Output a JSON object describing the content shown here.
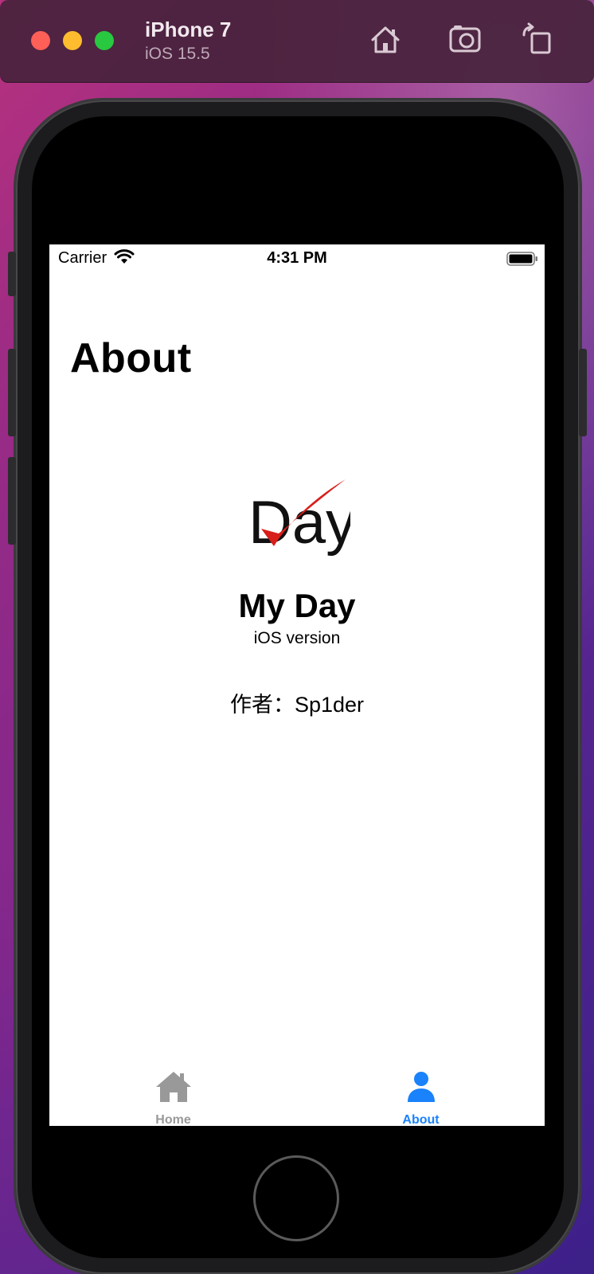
{
  "simulator": {
    "device_name": "iPhone 7",
    "os_version": "iOS 15.5",
    "icons": [
      "home-icon",
      "screenshot-camera-icon",
      "rotate-icon"
    ]
  },
  "status_bar": {
    "carrier": "Carrier",
    "time": "4:31 PM"
  },
  "page": {
    "title": "About",
    "logo_text": "Day",
    "app_name": "My Day",
    "app_subtitle": "iOS version",
    "author": "作者：Sp1der"
  },
  "tab_bar": {
    "items": [
      {
        "label": "Home",
        "icon": "house-icon",
        "selected": false
      },
      {
        "label": "About",
        "icon": "person-icon",
        "selected": true
      }
    ],
    "colors": {
      "selected": "#1a82fb",
      "unselected": "#999999"
    }
  },
  "colors": {
    "logo_check": "#d81e1a",
    "traffic_red": "#fe5f57",
    "traffic_yellow": "#febc2e",
    "traffic_green": "#28c840"
  }
}
